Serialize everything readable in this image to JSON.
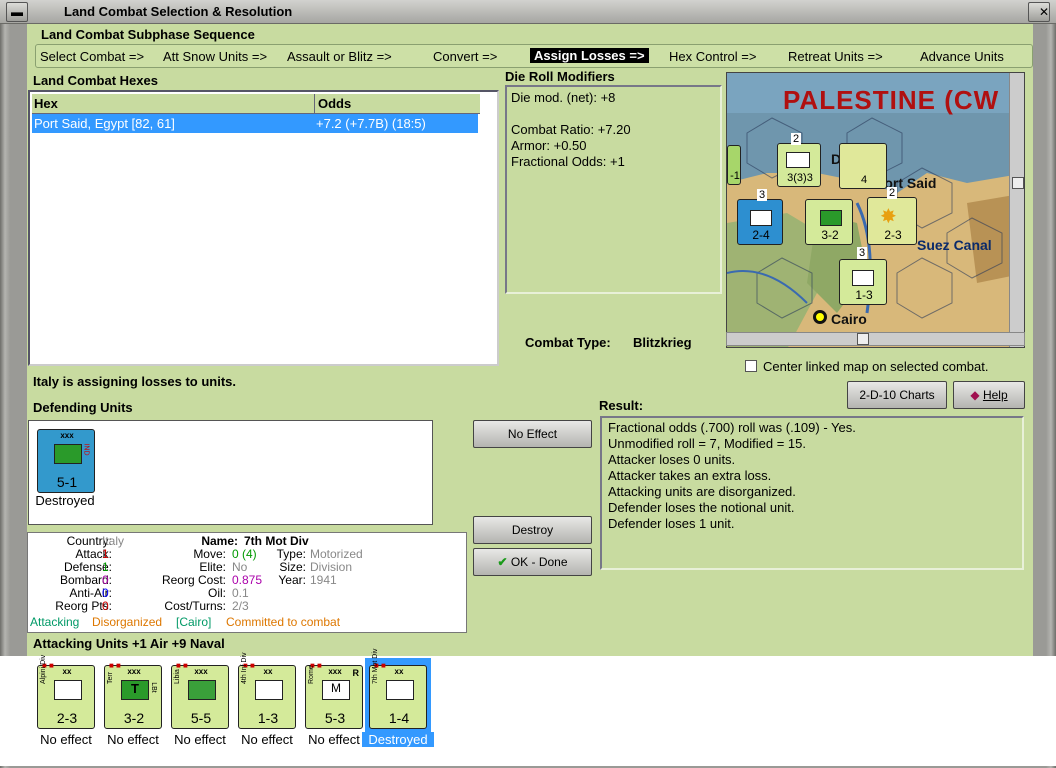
{
  "window": {
    "title": "Land Combat Selection & Resolution"
  },
  "subphase": {
    "title": "Land Combat Subphase Sequence",
    "steps": [
      "Select Combat =>",
      "Att Snow Units =>",
      "Assault or Blitz =>",
      "Convert =>",
      "Assign Losses =>",
      "Hex Control =>",
      "Retreat Units =>",
      "Advance Units"
    ],
    "active_index": 4
  },
  "hexes": {
    "title": "Land Combat Hexes",
    "columns": [
      "Hex",
      "Odds"
    ],
    "rows": [
      {
        "hex": "Port Said, Egypt [82, 61]",
        "odds": "+7.2 (+7.7B) (18:5)"
      }
    ]
  },
  "modifiers": {
    "title": "Die Roll Modifiers",
    "net": "Die mod. (net): +8",
    "lines": [
      "Combat Ratio: +7.20",
      "Armor: +0.50",
      "Fractional Odds: +1"
    ]
  },
  "combat_type": {
    "label": "Combat Type:",
    "value": "Blitzkrieg"
  },
  "map": {
    "region_title": "PALESTINE (CW",
    "places": [
      "Port Said",
      "Suez Canal",
      "Cairo",
      "Da"
    ],
    "units": [
      {
        "strength": "3(3)3"
      },
      {
        "strength": "2-4"
      },
      {
        "strength": "3-2"
      },
      {
        "strength": "2-3"
      },
      {
        "strength": "1-3"
      },
      {
        "strength": "-1"
      }
    ],
    "stack_counts": [
      "2",
      "3",
      "4",
      "2",
      "3",
      "3"
    ],
    "center_linked_label": "Center linked map on selected combat."
  },
  "status_msg": "Italy is assigning losses to units.",
  "buttons": {
    "charts": "2-D-10 Charts",
    "help": "Help",
    "no_effect": "No Effect",
    "destroy": "Destroy",
    "ok_done": "OK - Done"
  },
  "defending": {
    "title": "Defending Units",
    "units": [
      {
        "name": "7th Ind Garr",
        "size": "xxx",
        "strength": "5-1",
        "nation": "IND",
        "caption": "Destroyed",
        "color": "#3399cc"
      }
    ]
  },
  "result": {
    "title": "Result:",
    "lines": [
      "Fractional odds (.700) roll was (.109)  - Yes.",
      "Unmodified roll = 7, Modified = 15.",
      "Attacker loses 0 units.",
      "Attacker takes an extra loss.",
      "Attacking units are disorganized.",
      "Defender loses the notional unit.",
      "Defender loses 1 unit."
    ]
  },
  "details": {
    "country_label": "Country:",
    "country": "Italy",
    "attack_label": "Attack:",
    "attack": "1",
    "defense_label": "Defense:",
    "defense": "1",
    "bombard_label": "Bombard:",
    "bombard": "0",
    "antiair_label": "Anti-Air:",
    "antiair": "0",
    "reorg_pts_label": "Reorg Pts:",
    "reorg_pts": "0",
    "name_label": "Name:",
    "name": "7th Mot Div",
    "move_label": "Move:",
    "move": "0 (4)",
    "elite_label": "Elite:",
    "elite": "No",
    "reorg_cost_label": "Reorg Cost:",
    "reorg_cost": "0.875",
    "oil_label": "Oil:",
    "oil": "0.1",
    "cost_turns_label": "Cost/Turns:",
    "cost_turns": "2/3",
    "type_label": "Type:",
    "type": "Motorized",
    "size_label": "Size:",
    "size": "Division",
    "year_label": "Year:",
    "year": "1941",
    "status_attacking": "Attacking",
    "status_disorganized": "Disorganized",
    "status_location": "[Cairo]",
    "status_committed": "Committed to combat"
  },
  "attacking": {
    "title": "Attacking Units +1 Air +9 Naval",
    "units": [
      {
        "name": "Alpini Div",
        "size": "xx",
        "strength": "2-3",
        "caption": "No effect",
        "symbol": "mountain"
      },
      {
        "name": "Terr",
        "extra": "LBt",
        "size": "xxx",
        "strength": "3-2",
        "caption": "No effect",
        "symbol": "T"
      },
      {
        "name": "Libia",
        "size": "xxx",
        "strength": "5-5",
        "caption": "No effect",
        "symbol": "inf"
      },
      {
        "name": "4th Inf Div",
        "size": "xx",
        "strength": "1-3",
        "caption": "No effect",
        "symbol": "inf"
      },
      {
        "name": "Rome",
        "size": "xxx",
        "strength": "5-3",
        "caption": "No effect",
        "symbol": "M",
        "extra": "R"
      },
      {
        "name": "7th Mot Div",
        "size": "xx",
        "strength": "1-4",
        "caption": "Destroyed",
        "symbol": "mot",
        "selected": true
      }
    ]
  }
}
